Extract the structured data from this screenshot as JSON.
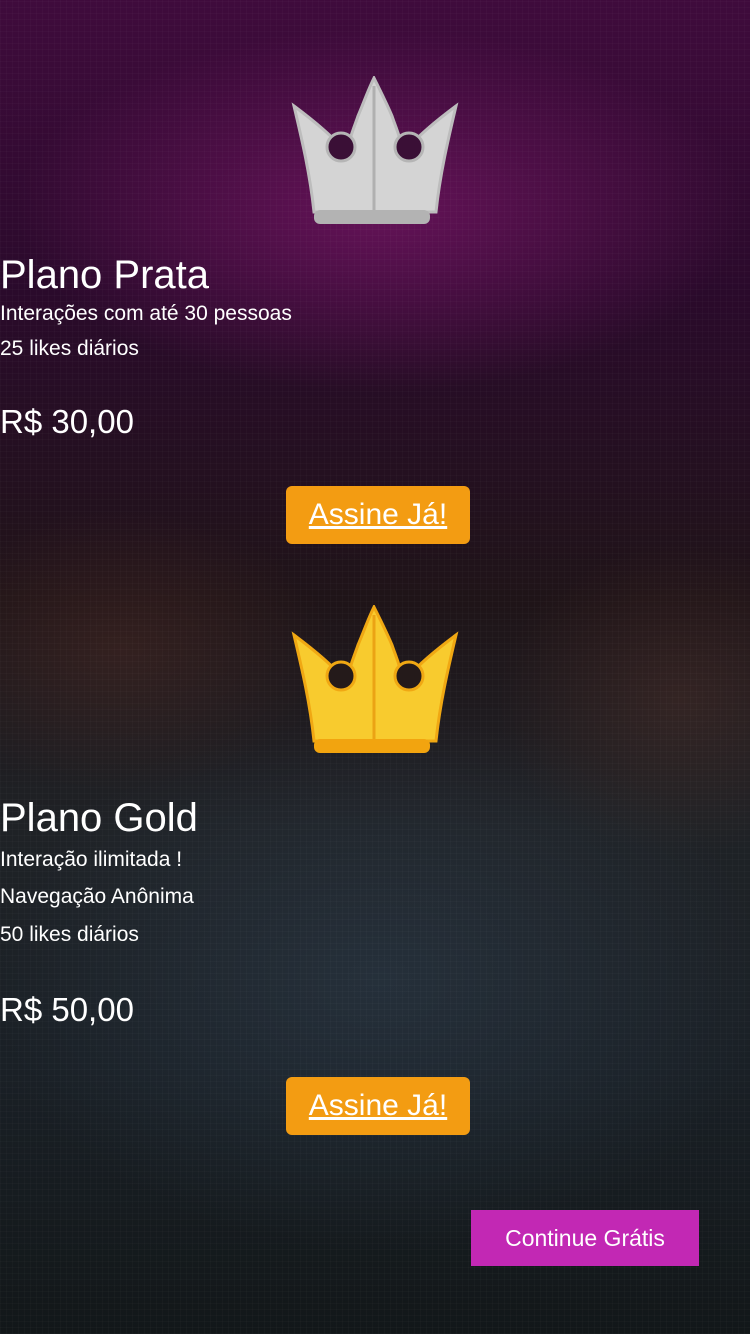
{
  "colors": {
    "silver_crown": "#d6d6d6",
    "gold_crown": "#f8c72c",
    "button": "#f39c12",
    "continue_button": "#c228b4"
  },
  "plans": [
    {
      "icon": "silver-crown-icon",
      "title": "Plano Prata",
      "features": [
        "Interações com até 30 pessoas",
        "25 likes diários"
      ],
      "price": "R$ 30,00",
      "button": "Assine Já!"
    },
    {
      "icon": "gold-crown-icon",
      "title": "Plano Gold",
      "features": [
        "Interação ilimitada !",
        "Navegação Anônima",
        "50 likes diários"
      ],
      "price": "R$ 50,00",
      "button": "Assine Já!"
    }
  ],
  "continue_label": "Continue Grátis"
}
